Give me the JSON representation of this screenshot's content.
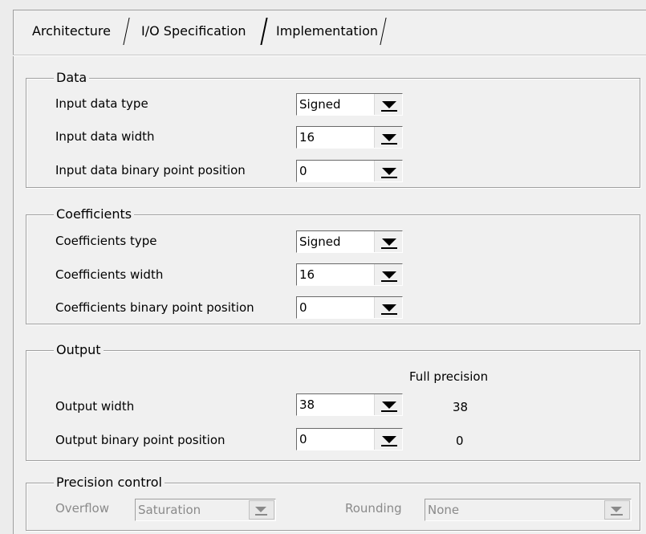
{
  "tabs": [
    {
      "label": "Architecture"
    },
    {
      "label": "I/O Specification"
    },
    {
      "label": "Implementation"
    }
  ],
  "data_group": {
    "legend": "Data",
    "rows": [
      {
        "label": "Input data type",
        "value": "Signed"
      },
      {
        "label": "Input data width",
        "value": "16"
      },
      {
        "label": "Input data binary point position",
        "value": "0"
      }
    ]
  },
  "coeff_group": {
    "legend": "Coefficients",
    "rows": [
      {
        "label": "Coefficients type",
        "value": "Signed"
      },
      {
        "label": "Coefficients width",
        "value": "16"
      },
      {
        "label": "Coefficients binary point position",
        "value": "0"
      }
    ]
  },
  "output_group": {
    "legend": "Output",
    "full_precision_header": "Full precision",
    "rows": [
      {
        "label": "Output width",
        "value": "38",
        "full_precision": "38"
      },
      {
        "label": "Output binary point position",
        "value": "0",
        "full_precision": "0"
      }
    ]
  },
  "precision_group": {
    "legend": "Precision control",
    "overflow_label": "Overflow",
    "overflow_value": "Saturation",
    "rounding_label": "Rounding",
    "rounding_value": "None"
  }
}
